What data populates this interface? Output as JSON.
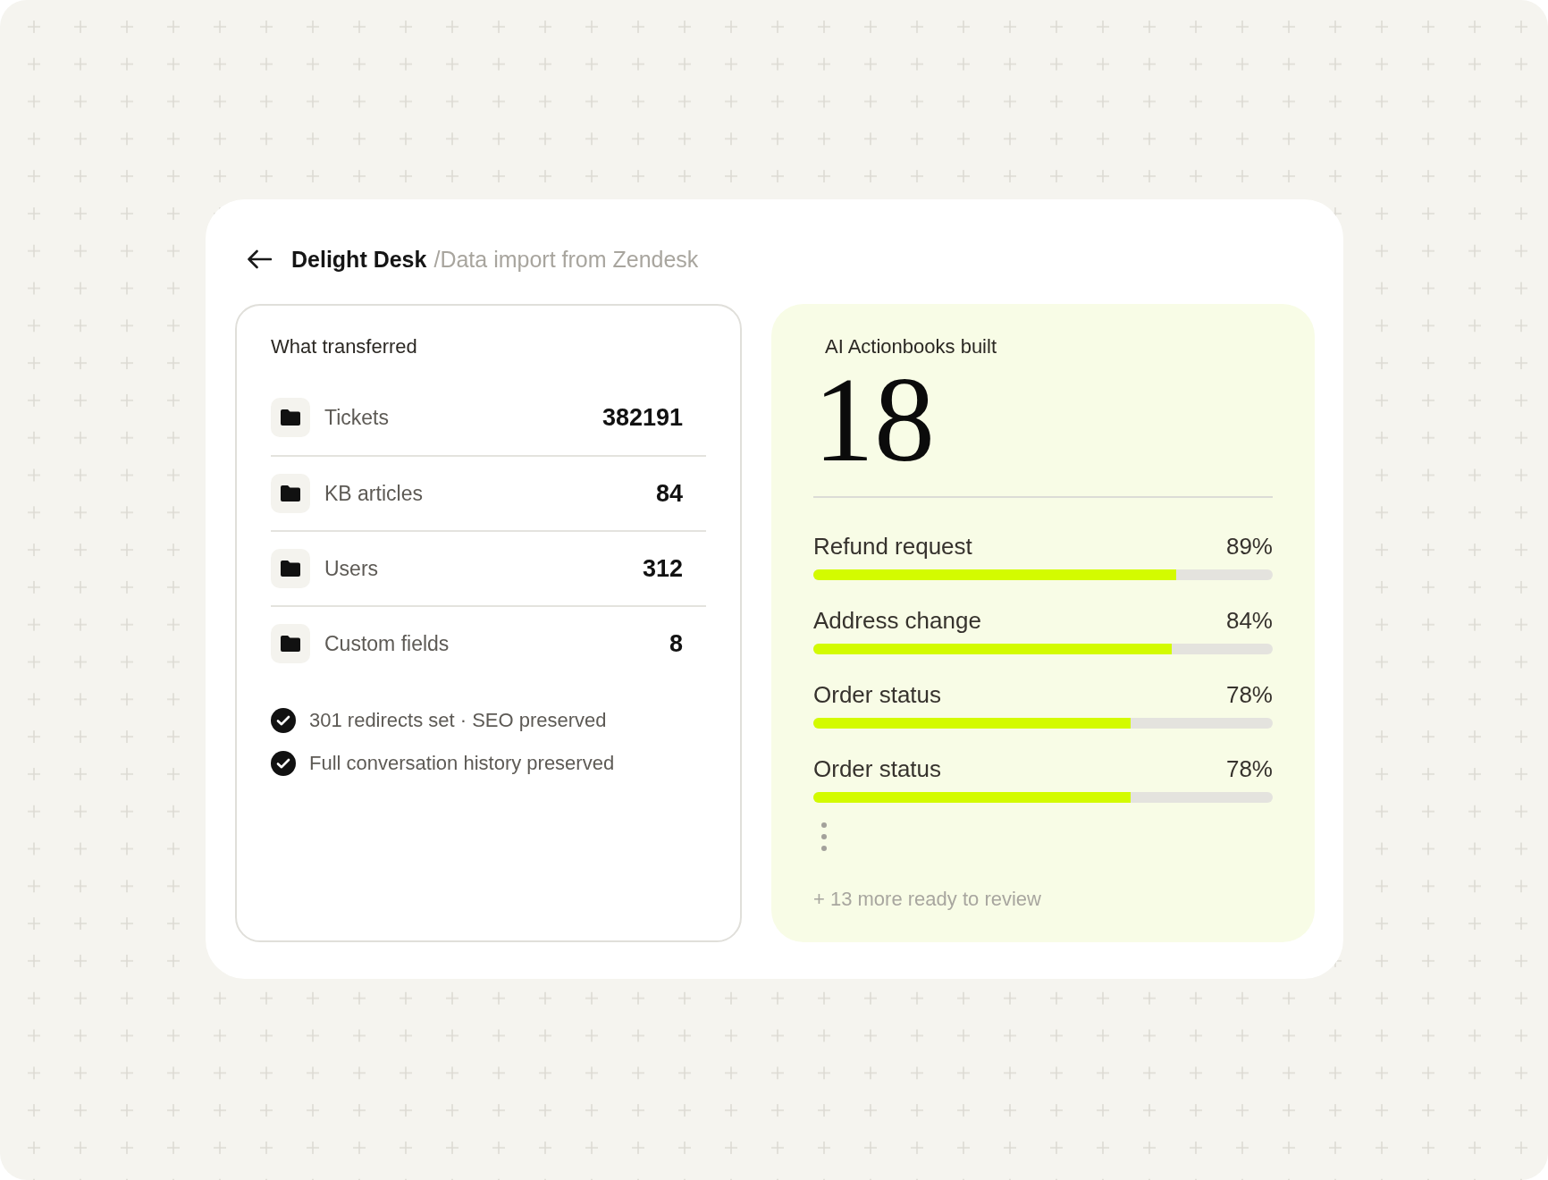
{
  "header": {
    "title": "Delight Desk",
    "breadcrumb": "/Data import from Zendesk"
  },
  "transfer_panel": {
    "title": "What transferred",
    "items": [
      {
        "label": "Tickets",
        "count": "382191"
      },
      {
        "label": "KB articles",
        "count": "84"
      },
      {
        "label": "Users",
        "count": "312"
      },
      {
        "label": "Custom fields",
        "count": "8"
      }
    ],
    "checks": [
      {
        "text": "301 redirects set · SEO preserved",
        "checked": true
      },
      {
        "text": "Full conversation history preserved",
        "checked": true
      }
    ]
  },
  "actionbooks_panel": {
    "title": "AI Actionbooks built",
    "count": "18",
    "items": [
      {
        "label": "Refund request",
        "percent": "89%",
        "level": 0.79
      },
      {
        "label": "Address change",
        "percent": "84%",
        "level": 0.78
      },
      {
        "label": "Order status",
        "percent": "78%",
        "level": 0.69
      },
      {
        "label": "Order status",
        "percent": "78%",
        "level": 0.69
      }
    ],
    "more": "+ 13 more ready to review"
  }
}
